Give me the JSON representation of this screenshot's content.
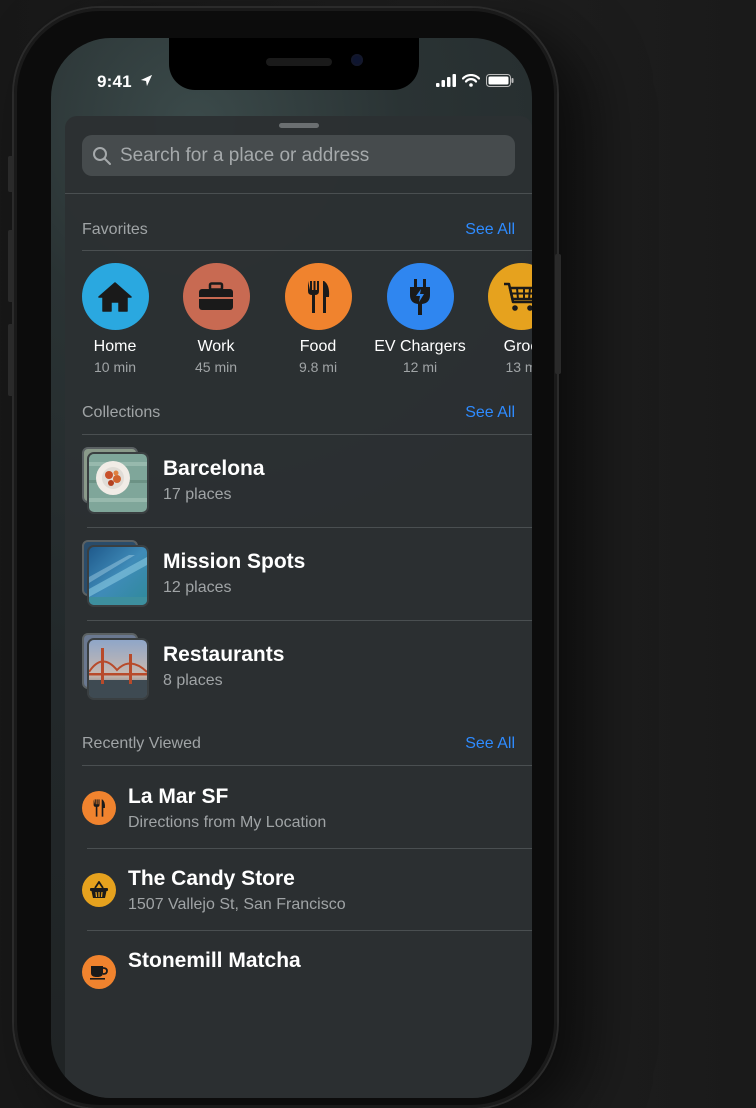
{
  "status": {
    "time": "9:41"
  },
  "search": {
    "placeholder": "Search for a place or address"
  },
  "favorites": {
    "header": "Favorites",
    "see_all": "See All",
    "items": [
      {
        "label": "Home",
        "sub": "10 min",
        "color": "#2aa8e0",
        "icon": "house-icon"
      },
      {
        "label": "Work",
        "sub": "45 min",
        "color": "#c86a52",
        "icon": "briefcase-icon"
      },
      {
        "label": "Food",
        "sub": "9.8 mi",
        "color": "#f0832e",
        "icon": "fork-knife-icon"
      },
      {
        "label": "EV Chargers",
        "sub": "12 mi",
        "color": "#2f86f0",
        "icon": "ev-plug-icon"
      },
      {
        "label": "Groc",
        "sub": "13 m",
        "color": "#e6a21e",
        "icon": "cart-icon"
      }
    ]
  },
  "collections": {
    "header": "Collections",
    "see_all": "See All",
    "items": [
      {
        "title": "Barcelona",
        "sub": "17 places"
      },
      {
        "title": "Mission Spots",
        "sub": "12 places"
      },
      {
        "title": "Restaurants",
        "sub": "8 places"
      }
    ]
  },
  "recent": {
    "header": "Recently Viewed",
    "see_all": "See All",
    "items": [
      {
        "title": "La Mar SF",
        "sub": "Directions from My Location",
        "color": "#f0832e",
        "icon": "fork-knife-icon"
      },
      {
        "title": "The Candy Store",
        "sub": "1507 Vallejo St, San Francisco",
        "color": "#e6a21e",
        "icon": "basket-icon"
      },
      {
        "title": "Stonemill Matcha",
        "sub": "",
        "color": "#f0832e",
        "icon": "coffee-cup-icon"
      }
    ]
  }
}
